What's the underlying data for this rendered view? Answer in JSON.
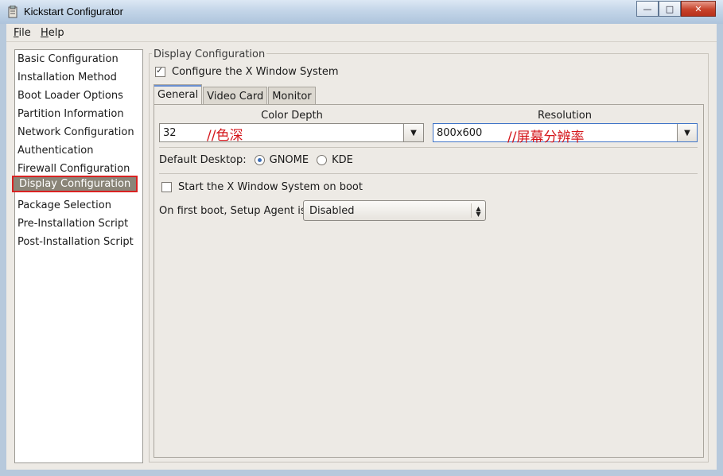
{
  "window": {
    "title": "Kickstart Configurator",
    "controls": {
      "minimize": "—",
      "maximize": "□",
      "close": "✕"
    }
  },
  "menubar": {
    "file": {
      "mnemonic": "F",
      "rest": "ile"
    },
    "help": {
      "mnemonic": "H",
      "rest": "elp"
    }
  },
  "sidebar": {
    "items": [
      {
        "label": "Basic Configuration"
      },
      {
        "label": "Installation Method"
      },
      {
        "label": "Boot Loader Options"
      },
      {
        "label": "Partition Information"
      },
      {
        "label": "Network Configuration"
      },
      {
        "label": "Authentication"
      },
      {
        "label": "Firewall Configuration"
      },
      {
        "label": "Display Configuration",
        "selected": true
      },
      {
        "label": "Package Selection"
      },
      {
        "label": "Pre-Installation Script"
      },
      {
        "label": "Post-Installation Script"
      }
    ]
  },
  "display": {
    "frame_title": "Display Configuration",
    "configure_x_label": "Configure the X Window System",
    "configure_x_checked": true,
    "tabs": [
      {
        "label": "General",
        "active": true
      },
      {
        "label": "Video Card",
        "active": false
      },
      {
        "label": "Monitor",
        "active": false
      }
    ],
    "color_depth": {
      "title": "Color Depth",
      "value": "32",
      "annotation": "//色深"
    },
    "resolution": {
      "title": "Resolution",
      "value": "800x600",
      "annotation": "//屏幕分辨率"
    },
    "default_desktop": {
      "label": "Default Desktop:",
      "options": [
        {
          "label": "GNOME",
          "selected": true
        },
        {
          "label": "KDE",
          "selected": false
        }
      ]
    },
    "start_x_on_boot": {
      "label": "Start the X Window System on boot",
      "checked": false
    },
    "setup_agent": {
      "label": "On first boot, Setup Agent is:",
      "value": "Disabled"
    }
  },
  "colors": {
    "selection_bg": "#8a8578",
    "highlight_border": "#d92222",
    "annotation": "#d4161b"
  }
}
